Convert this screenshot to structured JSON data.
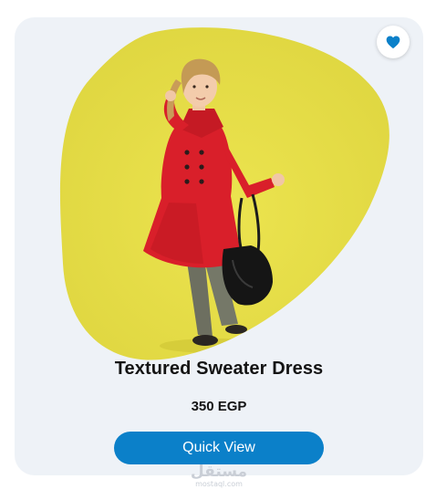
{
  "product": {
    "name": "Textured Sweater Dress",
    "price": "350 EGP",
    "image_alt": "Girl in red coat holding black bag on yellow background",
    "favorite": true
  },
  "actions": {
    "quick_view_label": "Quick View"
  },
  "watermark": {
    "arabic": "مستقل",
    "domain": "mostaql.com"
  },
  "colors": {
    "card_bg": "#eef2f7",
    "accent": "#0b80c9",
    "image_bg": "#e8df4a",
    "coat": "#d91f2a"
  },
  "icons": {
    "favorite": "heart-icon"
  }
}
